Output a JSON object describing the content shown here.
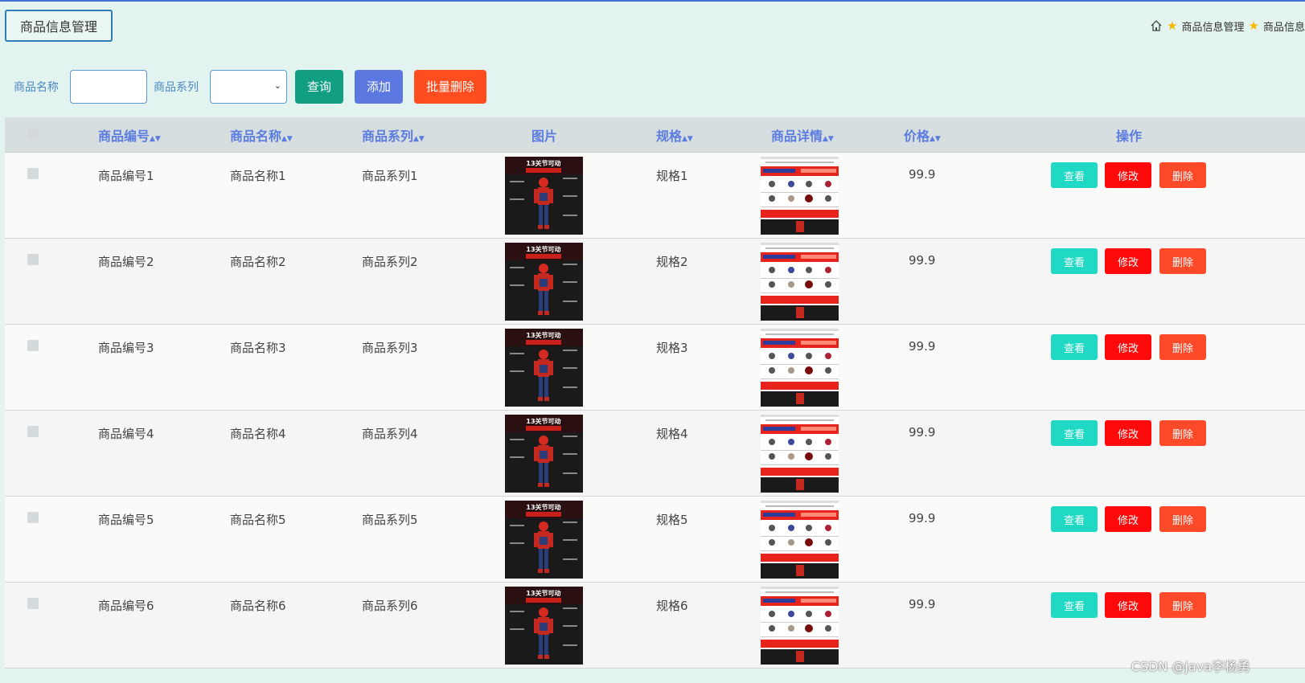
{
  "header": {
    "title": "商品信息管理",
    "breadcrumb": [
      "商品信息管理",
      "商品信息"
    ]
  },
  "filter": {
    "name_label": "商品名称",
    "name_value": "",
    "series_label": "商品系列",
    "series_value": "",
    "query_label": "查询",
    "add_label": "添加",
    "batch_delete_label": "批量删除"
  },
  "table": {
    "headers": {
      "code": "商品编号",
      "name": "商品名称",
      "series": "商品系列",
      "image": "图片",
      "spec": "规格",
      "detail": "商品详情",
      "price": "价格",
      "actions": "操作"
    },
    "rows": [
      {
        "code": "商品编号1",
        "name": "商品名称1",
        "series": "商品系列1",
        "spec": "规格1",
        "price": "99.9"
      },
      {
        "code": "商品编号2",
        "name": "商品名称2",
        "series": "商品系列2",
        "spec": "规格2",
        "price": "99.9"
      },
      {
        "code": "商品编号3",
        "name": "商品名称3",
        "series": "商品系列3",
        "spec": "规格3",
        "price": "99.9"
      },
      {
        "code": "商品编号4",
        "name": "商品名称4",
        "series": "商品系列4",
        "spec": "规格4",
        "price": "99.9"
      },
      {
        "code": "商品编号5",
        "name": "商品名称5",
        "series": "商品系列5",
        "spec": "规格5",
        "price": "99.9"
      },
      {
        "code": "商品编号6",
        "name": "商品名称6",
        "series": "商品系列6",
        "spec": "规格6",
        "price": "99.9"
      }
    ],
    "image_caption": "13关节可动",
    "actions": {
      "view": "查看",
      "edit": "修改",
      "delete": "删除"
    }
  },
  "watermark": "CSDN @java李杨勇",
  "colors": {
    "background": "#e3f3ef",
    "accent": "#5b7de0",
    "view": "#1fd9c4",
    "edit": "#ff0a0a",
    "delete": "#ff4a2a",
    "query": "#119e82"
  }
}
